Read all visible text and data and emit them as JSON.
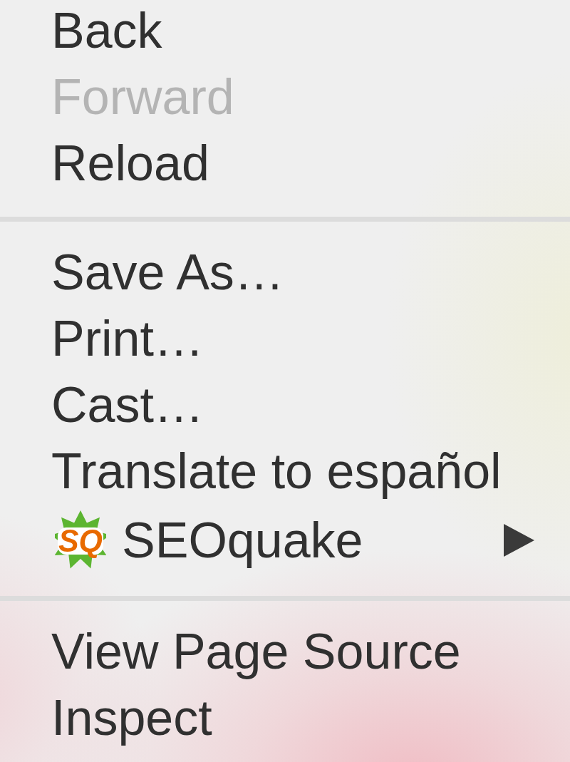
{
  "menu": {
    "groups": [
      {
        "items": [
          {
            "label": "Back",
            "disabled": false,
            "submenu": false
          },
          {
            "label": "Forward",
            "disabled": true,
            "submenu": false
          },
          {
            "label": "Reload",
            "disabled": false,
            "submenu": false
          }
        ]
      },
      {
        "items": [
          {
            "label": "Save As…",
            "disabled": false,
            "submenu": false
          },
          {
            "label": "Print…",
            "disabled": false,
            "submenu": false
          },
          {
            "label": "Cast…",
            "disabled": false,
            "submenu": false
          },
          {
            "label": "Translate to español",
            "disabled": false,
            "submenu": false
          },
          {
            "label": "SEOquake",
            "icon_text": "SQ",
            "disabled": false,
            "submenu": true
          }
        ]
      },
      {
        "items": [
          {
            "label": "View Page Source",
            "disabled": false,
            "submenu": false
          },
          {
            "label": "Inspect",
            "disabled": false,
            "submenu": false
          }
        ]
      }
    ]
  }
}
